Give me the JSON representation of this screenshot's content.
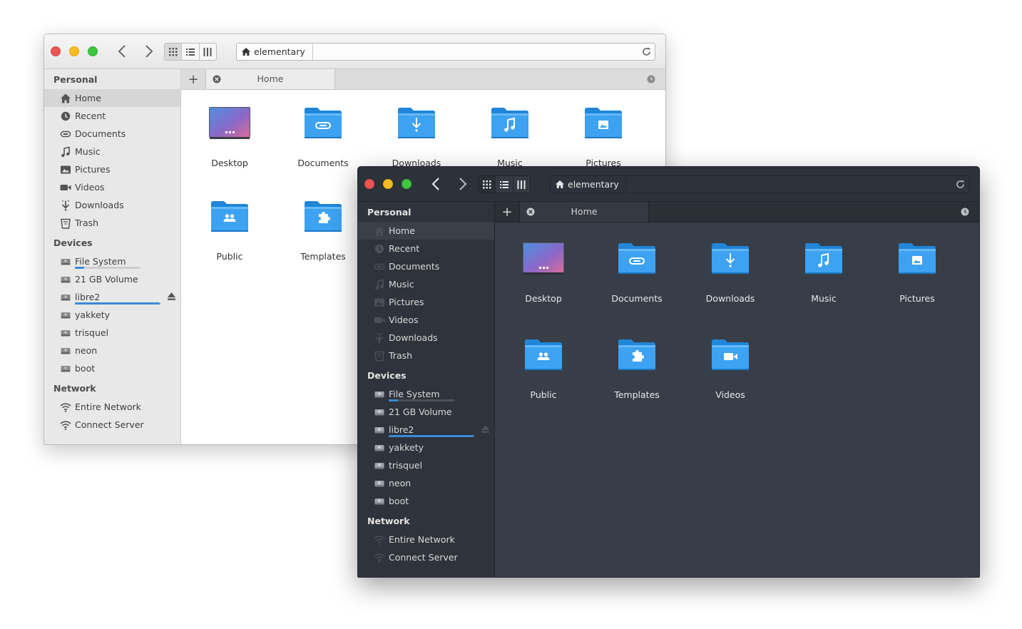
{
  "colors": {
    "close": "#ed5554",
    "minimize": "#f7bc1f",
    "maximize": "#3fc53f",
    "folder": "#3da2f1",
    "accent": "#3a8bd8"
  },
  "light_window": {
    "path": "elementary",
    "tab": {
      "label": "Home"
    },
    "sidebar": {
      "personal_header": "Personal",
      "personal": [
        {
          "label": "Home",
          "icon": "home-icon"
        },
        {
          "label": "Recent",
          "icon": "clock-icon"
        },
        {
          "label": "Documents",
          "icon": "paperclip-icon"
        },
        {
          "label": "Music",
          "icon": "music-note-icon"
        },
        {
          "label": "Pictures",
          "icon": "picture-icon"
        },
        {
          "label": "Videos",
          "icon": "video-camera-icon"
        },
        {
          "label": "Downloads",
          "icon": "download-icon"
        },
        {
          "label": "Trash",
          "icon": "trash-icon"
        }
      ],
      "devices_header": "Devices",
      "devices": [
        {
          "label": "File System",
          "usage": 0.14
        },
        {
          "label": "21 GB Volume"
        },
        {
          "label": "libre2",
          "usage": 0.98,
          "ejectable": true
        },
        {
          "label": "yakkety"
        },
        {
          "label": "trisquel"
        },
        {
          "label": "neon"
        },
        {
          "label": "boot"
        }
      ],
      "network_header": "Network",
      "network": [
        {
          "label": "Entire Network",
          "icon": "wifi-icon"
        },
        {
          "label": "Connect Server",
          "icon": "wifi-icon"
        }
      ]
    },
    "files": [
      {
        "label": "Desktop",
        "icon": "desktop-folder-icon"
      },
      {
        "label": "Documents",
        "icon": "documents-folder-icon"
      },
      {
        "label": "Downloads",
        "icon": "downloads-folder-icon"
      },
      {
        "label": "Music",
        "icon": "music-folder-icon"
      },
      {
        "label": "Pictures",
        "icon": "pictures-folder-icon"
      },
      {
        "label": "Public",
        "icon": "public-folder-icon"
      },
      {
        "label": "Templates",
        "icon": "templates-folder-icon"
      }
    ]
  },
  "dark_window": {
    "path": "elementary",
    "tab": {
      "label": "Home"
    },
    "sidebar": {
      "personal_header": "Personal",
      "personal": [
        {
          "label": "Home",
          "icon": "home-icon"
        },
        {
          "label": "Recent",
          "icon": "clock-icon"
        },
        {
          "label": "Documents",
          "icon": "paperclip-icon"
        },
        {
          "label": "Music",
          "icon": "music-note-icon"
        },
        {
          "label": "Pictures",
          "icon": "picture-icon"
        },
        {
          "label": "Videos",
          "icon": "video-camera-icon"
        },
        {
          "label": "Downloads",
          "icon": "download-icon"
        },
        {
          "label": "Trash",
          "icon": "trash-icon"
        }
      ],
      "devices_header": "Devices",
      "devices": [
        {
          "label": "File System",
          "usage": 0.14
        },
        {
          "label": "21 GB Volume"
        },
        {
          "label": "libre2",
          "usage": 0.98,
          "ejectable": true
        },
        {
          "label": "yakkety"
        },
        {
          "label": "trisquel"
        },
        {
          "label": "neon"
        },
        {
          "label": "boot"
        }
      ],
      "network_header": "Network",
      "network": [
        {
          "label": "Entire Network",
          "icon": "wifi-icon"
        },
        {
          "label": "Connect Server",
          "icon": "wifi-icon"
        }
      ]
    },
    "files": [
      {
        "label": "Desktop",
        "icon": "desktop-folder-icon"
      },
      {
        "label": "Documents",
        "icon": "documents-folder-icon"
      },
      {
        "label": "Downloads",
        "icon": "downloads-folder-icon"
      },
      {
        "label": "Music",
        "icon": "music-folder-icon"
      },
      {
        "label": "Pictures",
        "icon": "pictures-folder-icon"
      },
      {
        "label": "Public",
        "icon": "public-folder-icon"
      },
      {
        "label": "Templates",
        "icon": "templates-folder-icon"
      },
      {
        "label": "Videos",
        "icon": "videos-folder-icon"
      }
    ]
  }
}
